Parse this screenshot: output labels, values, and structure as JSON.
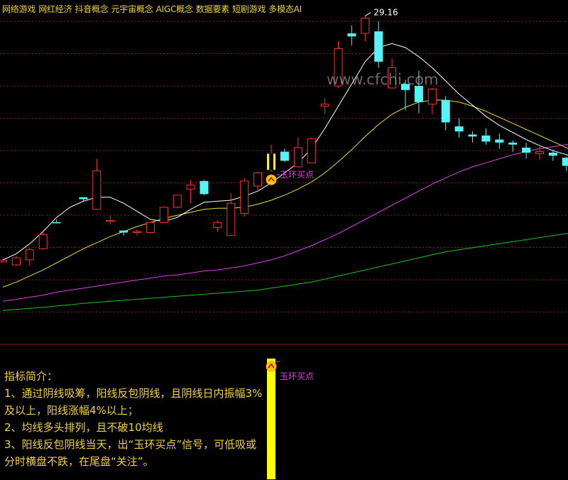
{
  "tags": [
    "网络游戏",
    "网红经济",
    "抖音概念",
    "元宇宙概念",
    "AIGC概念",
    "数据要素",
    "短剧游戏",
    "多模态AI"
  ],
  "watermark": "www.cfchi.com",
  "colors": {
    "up": "#ff3030",
    "down": "#54f5f8",
    "ma_white": "#ffffff",
    "ma_yellow": "#e8e030",
    "ma_magenta": "#e040e0",
    "ma_green": "#20c020",
    "signal": "#ffff00",
    "signal_text": "#e040e0",
    "grid": "#8a1a1a",
    "text": "#f2d23a"
  },
  "chart_data": {
    "type": "candlestick",
    "title": "",
    "max_price_label": "29.16",
    "signal_label": "玉环买点",
    "signal_candle_index": 20,
    "ylim": [
      14.5,
      29.6
    ],
    "grid": true,
    "candles": [
      [
        17.0,
        17.18,
        16.95,
        17.08
      ],
      [
        16.85,
        17.3,
        16.8,
        17.2
      ],
      [
        17.1,
        17.7,
        16.8,
        17.6
      ],
      [
        17.65,
        18.45,
        17.6,
        18.35
      ],
      [
        18.96,
        19.1,
        18.9,
        18.95
      ],
      [
        null,
        null,
        null,
        null
      ],
      [
        20.2,
        20.2,
        20.0,
        20.1
      ],
      [
        19.6,
        22.1,
        19.6,
        21.5
      ],
      [
        19.02,
        19.3,
        18.85,
        19.05
      ],
      [
        18.55,
        18.55,
        18.3,
        18.45
      ],
      [
        18.45,
        18.6,
        18.3,
        18.5
      ],
      [
        18.45,
        18.95,
        18.4,
        18.95
      ],
      [
        18.95,
        19.75,
        18.9,
        19.7
      ],
      [
        19.7,
        20.3,
        19.65,
        20.3
      ],
      [
        20.6,
        21.05,
        19.9,
        20.8
      ],
      [
        21.0,
        21.05,
        20.3,
        20.35
      ],
      [
        18.7,
        19.05,
        18.5,
        18.95
      ],
      [
        18.3,
        20.4,
        18.3,
        19.9
      ],
      [
        19.4,
        21.15,
        19.25,
        21.0
      ],
      [
        20.75,
        21.45,
        20.5,
        21.4
      ],
      [
        21.55,
        22.8,
        21.45,
        22.35
      ],
      [
        22.45,
        22.6,
        21.95,
        22.0
      ],
      [
        21.7,
        23.15,
        21.7,
        22.65
      ],
      [
        21.9,
        23.15,
        21.9,
        23.1
      ],
      [
        24.7,
        25.1,
        24.3,
        24.8
      ],
      [
        25.7,
        27.9,
        25.6,
        27.55
      ],
      [
        28.3,
        28.7,
        27.7,
        28.15
      ],
      [
        28.3,
        29.16,
        27.9,
        29.05
      ],
      [
        28.4,
        28.9,
        26.6,
        26.9
      ],
      [
        25.6,
        27.05,
        25.6,
        26.6
      ],
      [
        25.8,
        26.0,
        24.5,
        25.5
      ],
      [
        25.7,
        26.45,
        24.35,
        24.9
      ],
      [
        24.8,
        25.6,
        24.3,
        25.55
      ],
      [
        25.0,
        25.2,
        23.5,
        23.9
      ],
      [
        23.7,
        24.1,
        23.15,
        23.45
      ],
      [
        23.3,
        23.45,
        22.9,
        23.2
      ],
      [
        23.25,
        23.6,
        22.8,
        22.95
      ],
      [
        23.05,
        23.35,
        22.6,
        22.9
      ],
      [
        22.9,
        23.0,
        22.45,
        22.8
      ],
      [
        22.65,
        22.9,
        22.1,
        22.4
      ],
      [
        22.35,
        22.7,
        22.05,
        22.45
      ],
      [
        22.4,
        22.55,
        22.0,
        22.25
      ],
      [
        22.15,
        22.2,
        21.5,
        21.75
      ],
      [
        21.4,
        21.7,
        21.35,
        21.7
      ],
      [
        21.75,
        21.95,
        21.35,
        21.45
      ],
      [
        21.45,
        21.65,
        21.35,
        21.65
      ]
    ],
    "ma_white": [
      17.1,
      17.4,
      17.9,
      18.5,
      19.2,
      19.7,
      20.0,
      20.2,
      20.2,
      19.9,
      19.5,
      19.1,
      19.0,
      19.2,
      19.6,
      19.95,
      20.0,
      20.05,
      20.25,
      20.5,
      20.9,
      21.4,
      21.9,
      22.6,
      23.6,
      24.7,
      25.8,
      26.9,
      27.6,
      27.8,
      27.6,
      27.15,
      26.6,
      25.95,
      25.3,
      24.75,
      24.2,
      23.75,
      23.4,
      23.05,
      22.75,
      22.5,
      22.3,
      22.1,
      21.95,
      21.85
    ],
    "ma_yellow": [
      15.75,
      16.0,
      16.3,
      16.6,
      16.95,
      17.3,
      17.65,
      17.95,
      18.25,
      18.5,
      18.75,
      18.95,
      19.15,
      19.3,
      19.45,
      19.6,
      19.65,
      19.65,
      19.7,
      19.85,
      20.05,
      20.3,
      20.6,
      20.95,
      21.4,
      21.95,
      22.55,
      23.2,
      23.8,
      24.3,
      24.65,
      24.9,
      25.0,
      25.0,
      24.9,
      24.7,
      24.45,
      24.15,
      23.85,
      23.55,
      23.25,
      22.95,
      22.65,
      22.35,
      22.1,
      21.85
    ],
    "ma_magenta": [
      15.05,
      15.15,
      15.25,
      15.35,
      15.5,
      15.6,
      15.7,
      15.8,
      15.9,
      16.0,
      16.1,
      16.2,
      16.3,
      16.35,
      16.45,
      16.55,
      16.6,
      16.7,
      16.8,
      16.95,
      17.1,
      17.3,
      17.55,
      17.8,
      18.1,
      18.4,
      18.75,
      19.1,
      19.45,
      19.8,
      20.15,
      20.5,
      20.85,
      21.15,
      21.45,
      21.7,
      21.9,
      22.1,
      22.3,
      22.45,
      22.6,
      22.7,
      22.8,
      22.9,
      22.95,
      23.0
    ],
    "ma_green": [
      14.6,
      14.65,
      14.7,
      14.75,
      14.82,
      14.88,
      14.95,
      15.0,
      15.05,
      15.1,
      15.15,
      15.2,
      15.25,
      15.3,
      15.35,
      15.4,
      15.45,
      15.5,
      15.55,
      15.6,
      15.7,
      15.8,
      15.9,
      16.0,
      16.15,
      16.3,
      16.45,
      16.6,
      16.75,
      16.9,
      17.05,
      17.2,
      17.35,
      17.5,
      17.6,
      17.7,
      17.8,
      17.9,
      18.0,
      18.1,
      18.2,
      18.3,
      18.4,
      18.5,
      18.6,
      18.7
    ]
  },
  "intro": {
    "title": "指标简介：",
    "lines": [
      "1、通过阴线吸筹，阳线反包阴线，且阴线日内振幅3%及以上，阳线涨幅4%以上；",
      "2、均线多头排列，且不破10均线",
      "3、阳线反包阴线当天，出“玉环买点”信号，可低吸或分时横盘不跌，在尾盘“关注”。"
    ]
  }
}
